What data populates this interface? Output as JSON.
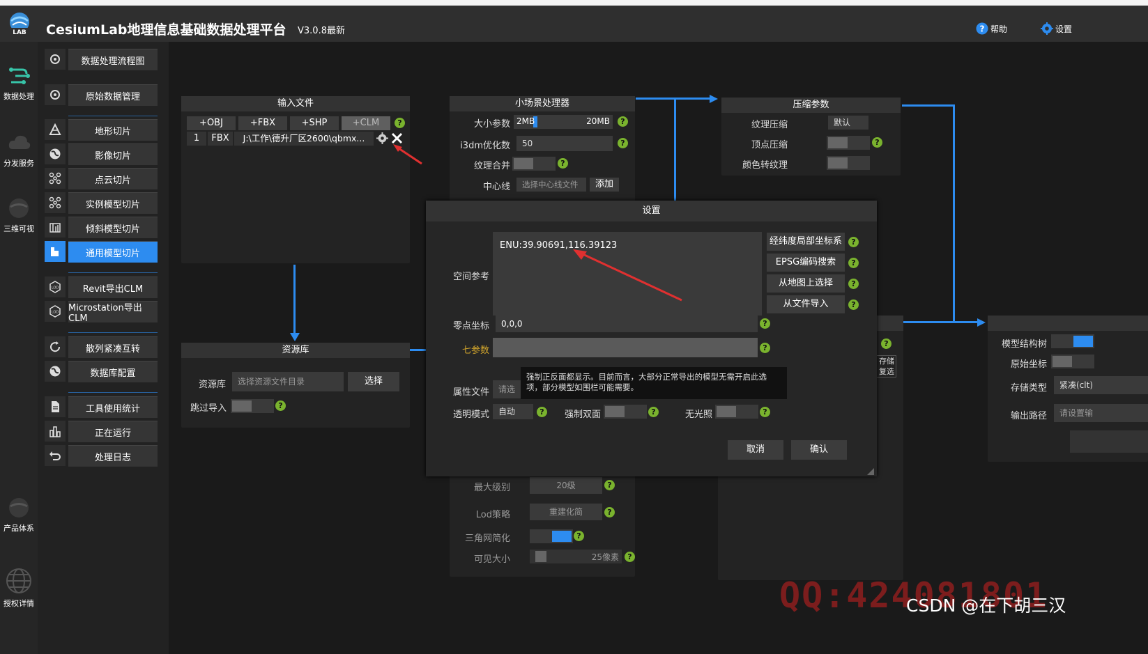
{
  "header": {
    "title": "CesiumLab地理信息基础数据处理平台",
    "version": "V3.0.8最新",
    "help_label": "帮助",
    "settings_label": "设置",
    "logo_text": "LAB"
  },
  "rail": {
    "items": [
      {
        "label": "数据处理"
      },
      {
        "label": "分发服务"
      },
      {
        "label": "三维可视"
      },
      {
        "label": "产品体系"
      },
      {
        "label": "授权详情"
      }
    ]
  },
  "menu": {
    "items": [
      {
        "label": "数据处理流程图",
        "icon": "gear-icon"
      },
      {
        "label": "原始数据管理",
        "icon": "gear-icon"
      },
      {
        "label": "地形切片",
        "icon": "terrain-icon"
      },
      {
        "label": "影像切片",
        "icon": "globe-icon"
      },
      {
        "label": "点云切片",
        "icon": "pointcloud-icon"
      },
      {
        "label": "实例模型切片",
        "icon": "pointcloud-icon"
      },
      {
        "label": "倾斜模型切片",
        "icon": "building-icon"
      },
      {
        "label": "通用模型切片",
        "icon": "model-icon"
      },
      {
        "label": "Revit导出CLM",
        "icon": "lod-icon"
      },
      {
        "label": "Microstation导出CLM",
        "icon": "lod-icon"
      },
      {
        "label": "散列紧凑互转",
        "icon": "refresh-icon"
      },
      {
        "label": "数据库配置",
        "icon": "globe-icon"
      },
      {
        "label": "工具使用统计",
        "icon": "document-icon"
      },
      {
        "label": "正在运行",
        "icon": "chart-icon"
      },
      {
        "label": "处理日志",
        "icon": "undo-icon"
      }
    ]
  },
  "input_node": {
    "title": "输入文件",
    "buttons": [
      "+OBJ",
      "+FBX",
      "+SHP",
      "+CLM"
    ],
    "file_row": {
      "index": "1",
      "type": "FBX",
      "path": "J:\\工作\\德升厂区2600\\qbmx..."
    }
  },
  "resource_node": {
    "title": "资源库",
    "label": "资源库",
    "placeholder": "选择资源文件目录",
    "select_label": "选择",
    "skip_label": "跳过导入"
  },
  "scene_node": {
    "title": "小场景处理器",
    "size_label": "大小参数",
    "size_min": "2MB",
    "size_max": "20MB",
    "i3dm_label": "i3dm优化数",
    "i3dm_value": "50",
    "merge_label": "纹理合并",
    "centerline_label": "中心线",
    "centerline_placeholder": "选择中心线文件",
    "add_label": "添加",
    "maxlevel_label": "最大级别",
    "maxlevel_value": "20级",
    "lod_label": "Lod策略",
    "lod_value": "重建化简",
    "simplify_label": "三角网简化",
    "visible_label": "可见大小",
    "visible_value": "25像素",
    "visible_fraction": 0.05
  },
  "compress_node": {
    "title": "压缩参数",
    "texture_label": "纹理压缩",
    "texture_value": "默认",
    "vertex_label": "顶点压缩",
    "color_label": "颜色转纹理"
  },
  "output_node": {
    "tree_label": "模型结构树",
    "origin_label": "原始坐标",
    "storage_label": "存储类型",
    "storage_value": "紧凑(clt)",
    "path_label": "输出路径",
    "path_placeholder": "请设置输"
  },
  "partial_node": {
    "text1": "存储",
    "text2": "复选"
  },
  "dialog": {
    "title": "设置",
    "spatial_label": "空间参考",
    "spatial_value": "ENU:39.90691,116.39123",
    "zero_label": "零点坐标",
    "zero_value": "0,0,0",
    "seven_label": "七参数",
    "attr_label": "属性文件",
    "attr_placeholder": "请选",
    "attr_select": "选择",
    "transparent_label": "透明模式",
    "transparent_value": "自动",
    "double_label": "强制双面",
    "nolight_label": "无光照",
    "side_buttons": [
      "经纬度局部坐标系",
      "EPSG编码搜索",
      "从地图上选择",
      "从文件导入"
    ],
    "cancel_label": "取消",
    "ok_label": "确认",
    "tooltip": "强制正反面都显示。目前而言，大部分正常导出的模型无需开启此选项，部分模型如围栏可能需要。"
  },
  "colors": {
    "accent": "#2d8cf0",
    "help": "#7ab32e",
    "watermark": "#8e1e1e"
  },
  "watermark": {
    "qq": "QQ:424081801",
    "csdn": "CSDN @在下胡三汉"
  }
}
